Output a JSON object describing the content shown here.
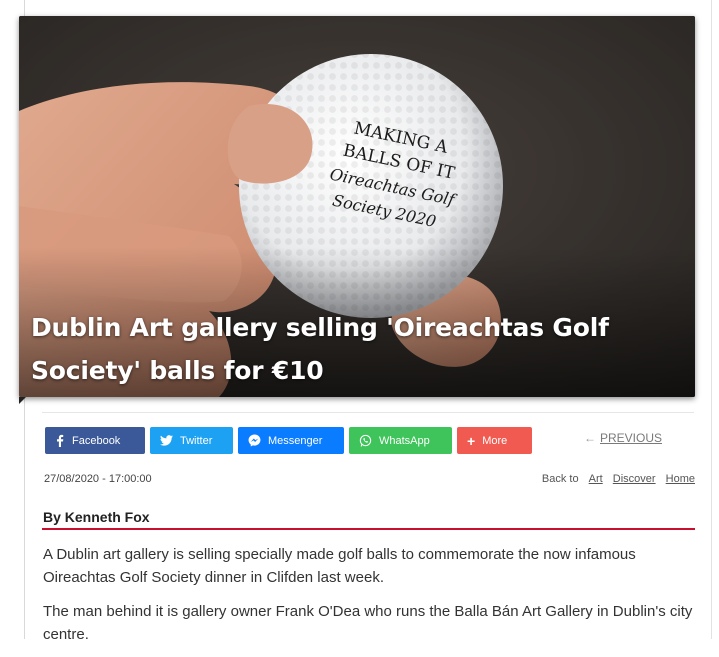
{
  "hero": {
    "title": "Dublin Art gallery selling 'Oireachtas Golf Society' balls for €10",
    "ball_text": [
      "MAKING A",
      "BALLS OF IT",
      "Oireachtas Golf",
      "Society 2020"
    ]
  },
  "share": {
    "facebook": "Facebook",
    "twitter": "Twitter",
    "messenger": "Messenger",
    "whatsapp": "WhatsApp",
    "more": "More"
  },
  "nav": {
    "previous": "PREVIOUS"
  },
  "meta": {
    "date": "27/08/2020 - 17:00:00",
    "back_to": "Back to",
    "crumbs": [
      "Art",
      "Discover",
      "Home"
    ]
  },
  "article": {
    "byline": "By Kenneth Fox",
    "paragraphs": [
      "A Dublin art gallery is selling specially made golf balls to commemorate the now infamous Oireachtas Golf Society dinner in Clifden last week.",
      "The man behind it is gallery owner Frank O'Dea who runs the Balla Bán Art Gallery in Dublin's city centre."
    ]
  },
  "colors": {
    "facebook": "#3b5998",
    "twitter": "#1da1f2",
    "messenger": "#0a7cff",
    "whatsapp": "#3ec45a",
    "more": "#f05a50",
    "accent_rule": "#c8102e"
  }
}
